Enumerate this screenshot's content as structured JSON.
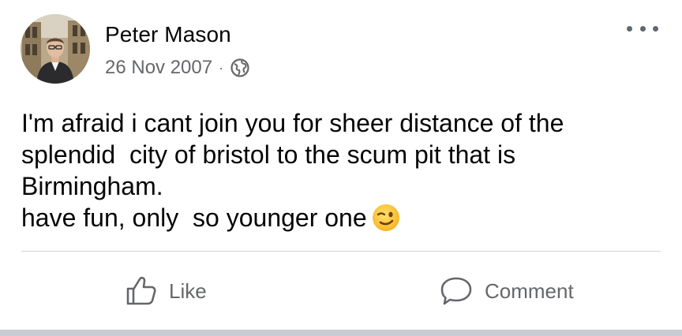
{
  "post": {
    "author": "Peter Mason",
    "date": "26 Nov 2007",
    "separator": "·",
    "audience_icon": "globe-icon",
    "menu_icon": "more-options-icon",
    "message_lines": [
      "I'm afraid i cant join you for sheer distance of the",
      "splendid  city of bristol to the scum pit that is",
      "Birmingham.",
      "have fun, only  so younger one"
    ],
    "emoji": "winking-face-emoji"
  },
  "actions": {
    "like_label": "Like",
    "like_icon": "thumbs-up-icon",
    "comment_label": "Comment",
    "comment_icon": "speech-bubble-icon"
  },
  "colors": {
    "text_primary": "#050505",
    "text_secondary": "#65676b",
    "divider": "#ced0d4",
    "bottom_bar": "#c9ccd1"
  }
}
